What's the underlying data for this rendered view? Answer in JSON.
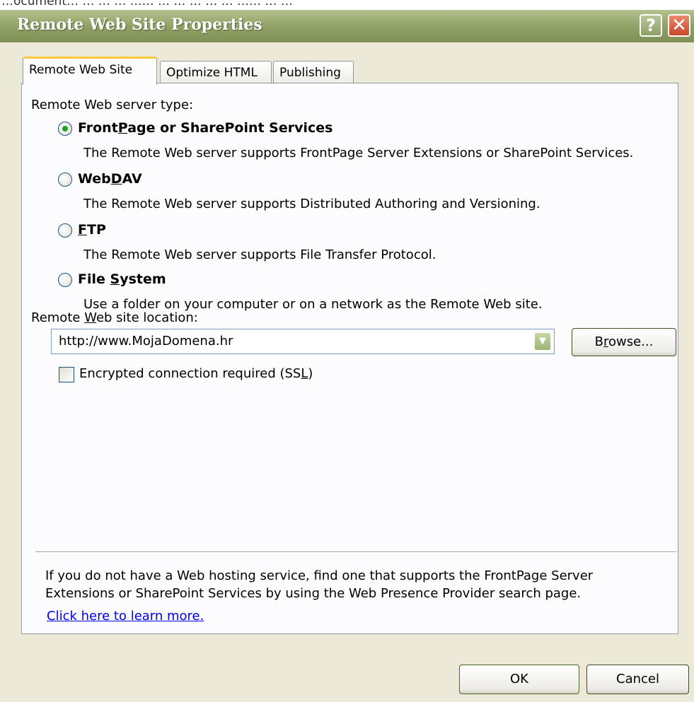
{
  "background_caption": "…ocument… … … … …… … … … … … …… … …",
  "window": {
    "title": "Remote Web Site Properties",
    "help_glyph": "?",
    "close_glyph": "✕"
  },
  "tabs": [
    {
      "label": "Remote Web Site",
      "active": true
    },
    {
      "label": "Optimize HTML",
      "active": false
    },
    {
      "label": "Publishing",
      "active": false
    }
  ],
  "server_type": {
    "heading": "Remote Web server type:",
    "options": [
      {
        "pre": "Front",
        "key": "P",
        "post": "age or SharePoint Services",
        "checked": true,
        "description": "The Remote Web server supports FrontPage Server Extensions or SharePoint Services."
      },
      {
        "pre": "Web",
        "key": "D",
        "post": "AV",
        "checked": false,
        "description": "The Remote Web server supports Distributed Authoring and Versioning."
      },
      {
        "pre": "",
        "key": "F",
        "post": "TP",
        "checked": false,
        "description": "The Remote Web server supports File Transfer Protocol."
      },
      {
        "pre": "File ",
        "key": "S",
        "post": "ystem",
        "checked": false,
        "description": "Use a folder on your computer or on a network as the Remote Web site."
      }
    ]
  },
  "location": {
    "label_pre": "Remote ",
    "label_key": "W",
    "label_post": "eb site location:",
    "value": "http://www.MojaDomena.hr",
    "browse_pre": "B",
    "browse_key": "r",
    "browse_post": "owse...",
    "ssl_pre": "Encrypted connection required (SS",
    "ssl_key": "L",
    "ssl_post": ")",
    "ssl_checked": false
  },
  "footer": {
    "info_line1": "If you do not have a Web hosting service, find one that supports the FrontPage Server",
    "info_line2": "Extensions or SharePoint Services by using the Web Presence Provider search page.",
    "link": "Click here to learn more."
  },
  "buttons": {
    "ok": "OK",
    "cancel": "Cancel"
  },
  "colors": {
    "titlebar": "#8d9f63",
    "dialog_bg": "#ece9d8",
    "tab_highlight": "#ffc83c",
    "radio_dot": "#21a121"
  }
}
